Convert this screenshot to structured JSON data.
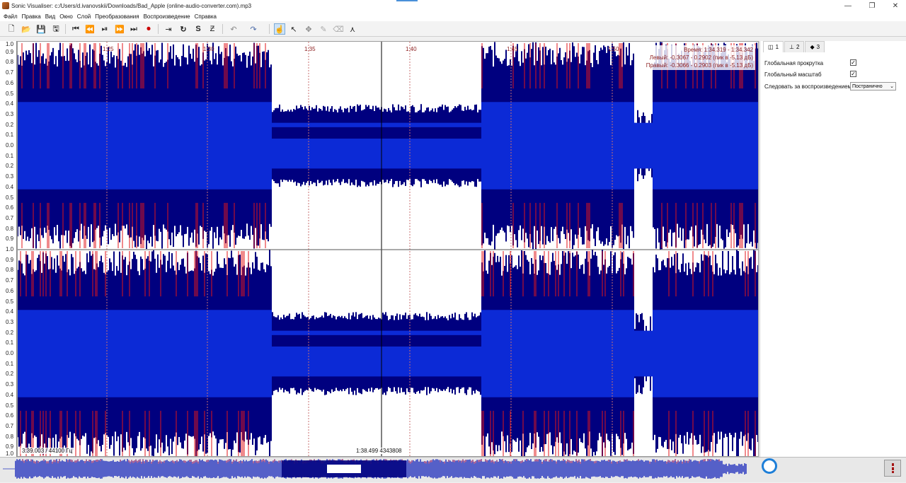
{
  "window": {
    "title": "Sonic Visualiser: c:/Users/d.ivanovskii/Downloads/Bad_Apple (online-audio-converter.com).mp3",
    "minimize": "—",
    "maximize": "❐",
    "close": "✕"
  },
  "menu": [
    "Файл",
    "Правка",
    "Вид",
    "Окно",
    "Слой",
    "Преобразования",
    "Воспроизведение",
    "Справка"
  ],
  "toolbar": {
    "new": "🗋",
    "open": "📂",
    "save": "💾",
    "save_as": "🖫",
    "rewind_start": "⏮",
    "rewind": "⏪",
    "play_pause": "⏯",
    "fast_forward": "⏩",
    "ffwd_end": "⏭",
    "record": "⏺",
    "play_selection": "⇥",
    "loop": "↻",
    "solo": "S",
    "follow": "Ƶ",
    "undo": "↶",
    "redo": "↷",
    "navigate": "☝",
    "select": "↖",
    "move": "✥",
    "draw": "✎",
    "erase": "⌫",
    "measure": "⋏"
  },
  "scale": {
    "labels": [
      "1.0",
      "0.9",
      "0.8",
      "0.7",
      "0.6",
      "0.5",
      "0.4",
      "0.3",
      "0.2",
      "0.1",
      "0.0",
      "0.1",
      "0.2",
      "0.3",
      "0.4",
      "0.5",
      "0.6",
      "0.7",
      "0.8",
      "0.9",
      "1.0",
      "0.9",
      "0.8",
      "0.7",
      "0.6",
      "0.5",
      "0.4",
      "0.3",
      "0.2",
      "0.1",
      "0.0",
      "0.1",
      "0.2",
      "0.3",
      "0.4",
      "0.5",
      "0.6",
      "0.7",
      "0.8",
      "0.9",
      "1.0"
    ]
  },
  "timeline": {
    "labels": [
      "1:25",
      "1:30",
      "1:35",
      "1:40",
      "1:45",
      "1:50"
    ]
  },
  "info": {
    "time": "Время: 1:34.319 - 1:34.342",
    "left": "Левый: -0.3067 - 0.2902 (пик в -5.13 дБ)",
    "right": "Правый: -0.3066 - 0.2903 (пик в -5.13 дБ)"
  },
  "readouts": {
    "position": "3:39.003 / 44100 Гц",
    "cursor": "1:38.499  4343808"
  },
  "panel": {
    "tabs": [
      "1",
      "2",
      "3"
    ],
    "global_scroll": "Глобальная прокрутка",
    "global_zoom": "Глобальный масштаб",
    "follow_playback": "Следовать за воспроизведением",
    "follow_value": "Постранично",
    "check": "✓"
  },
  "colors": {
    "wave_dark": "#00007f",
    "wave_light": "#0c2ad6",
    "clip_red": "#e0151a",
    "overview_blue": "#5560c8"
  }
}
